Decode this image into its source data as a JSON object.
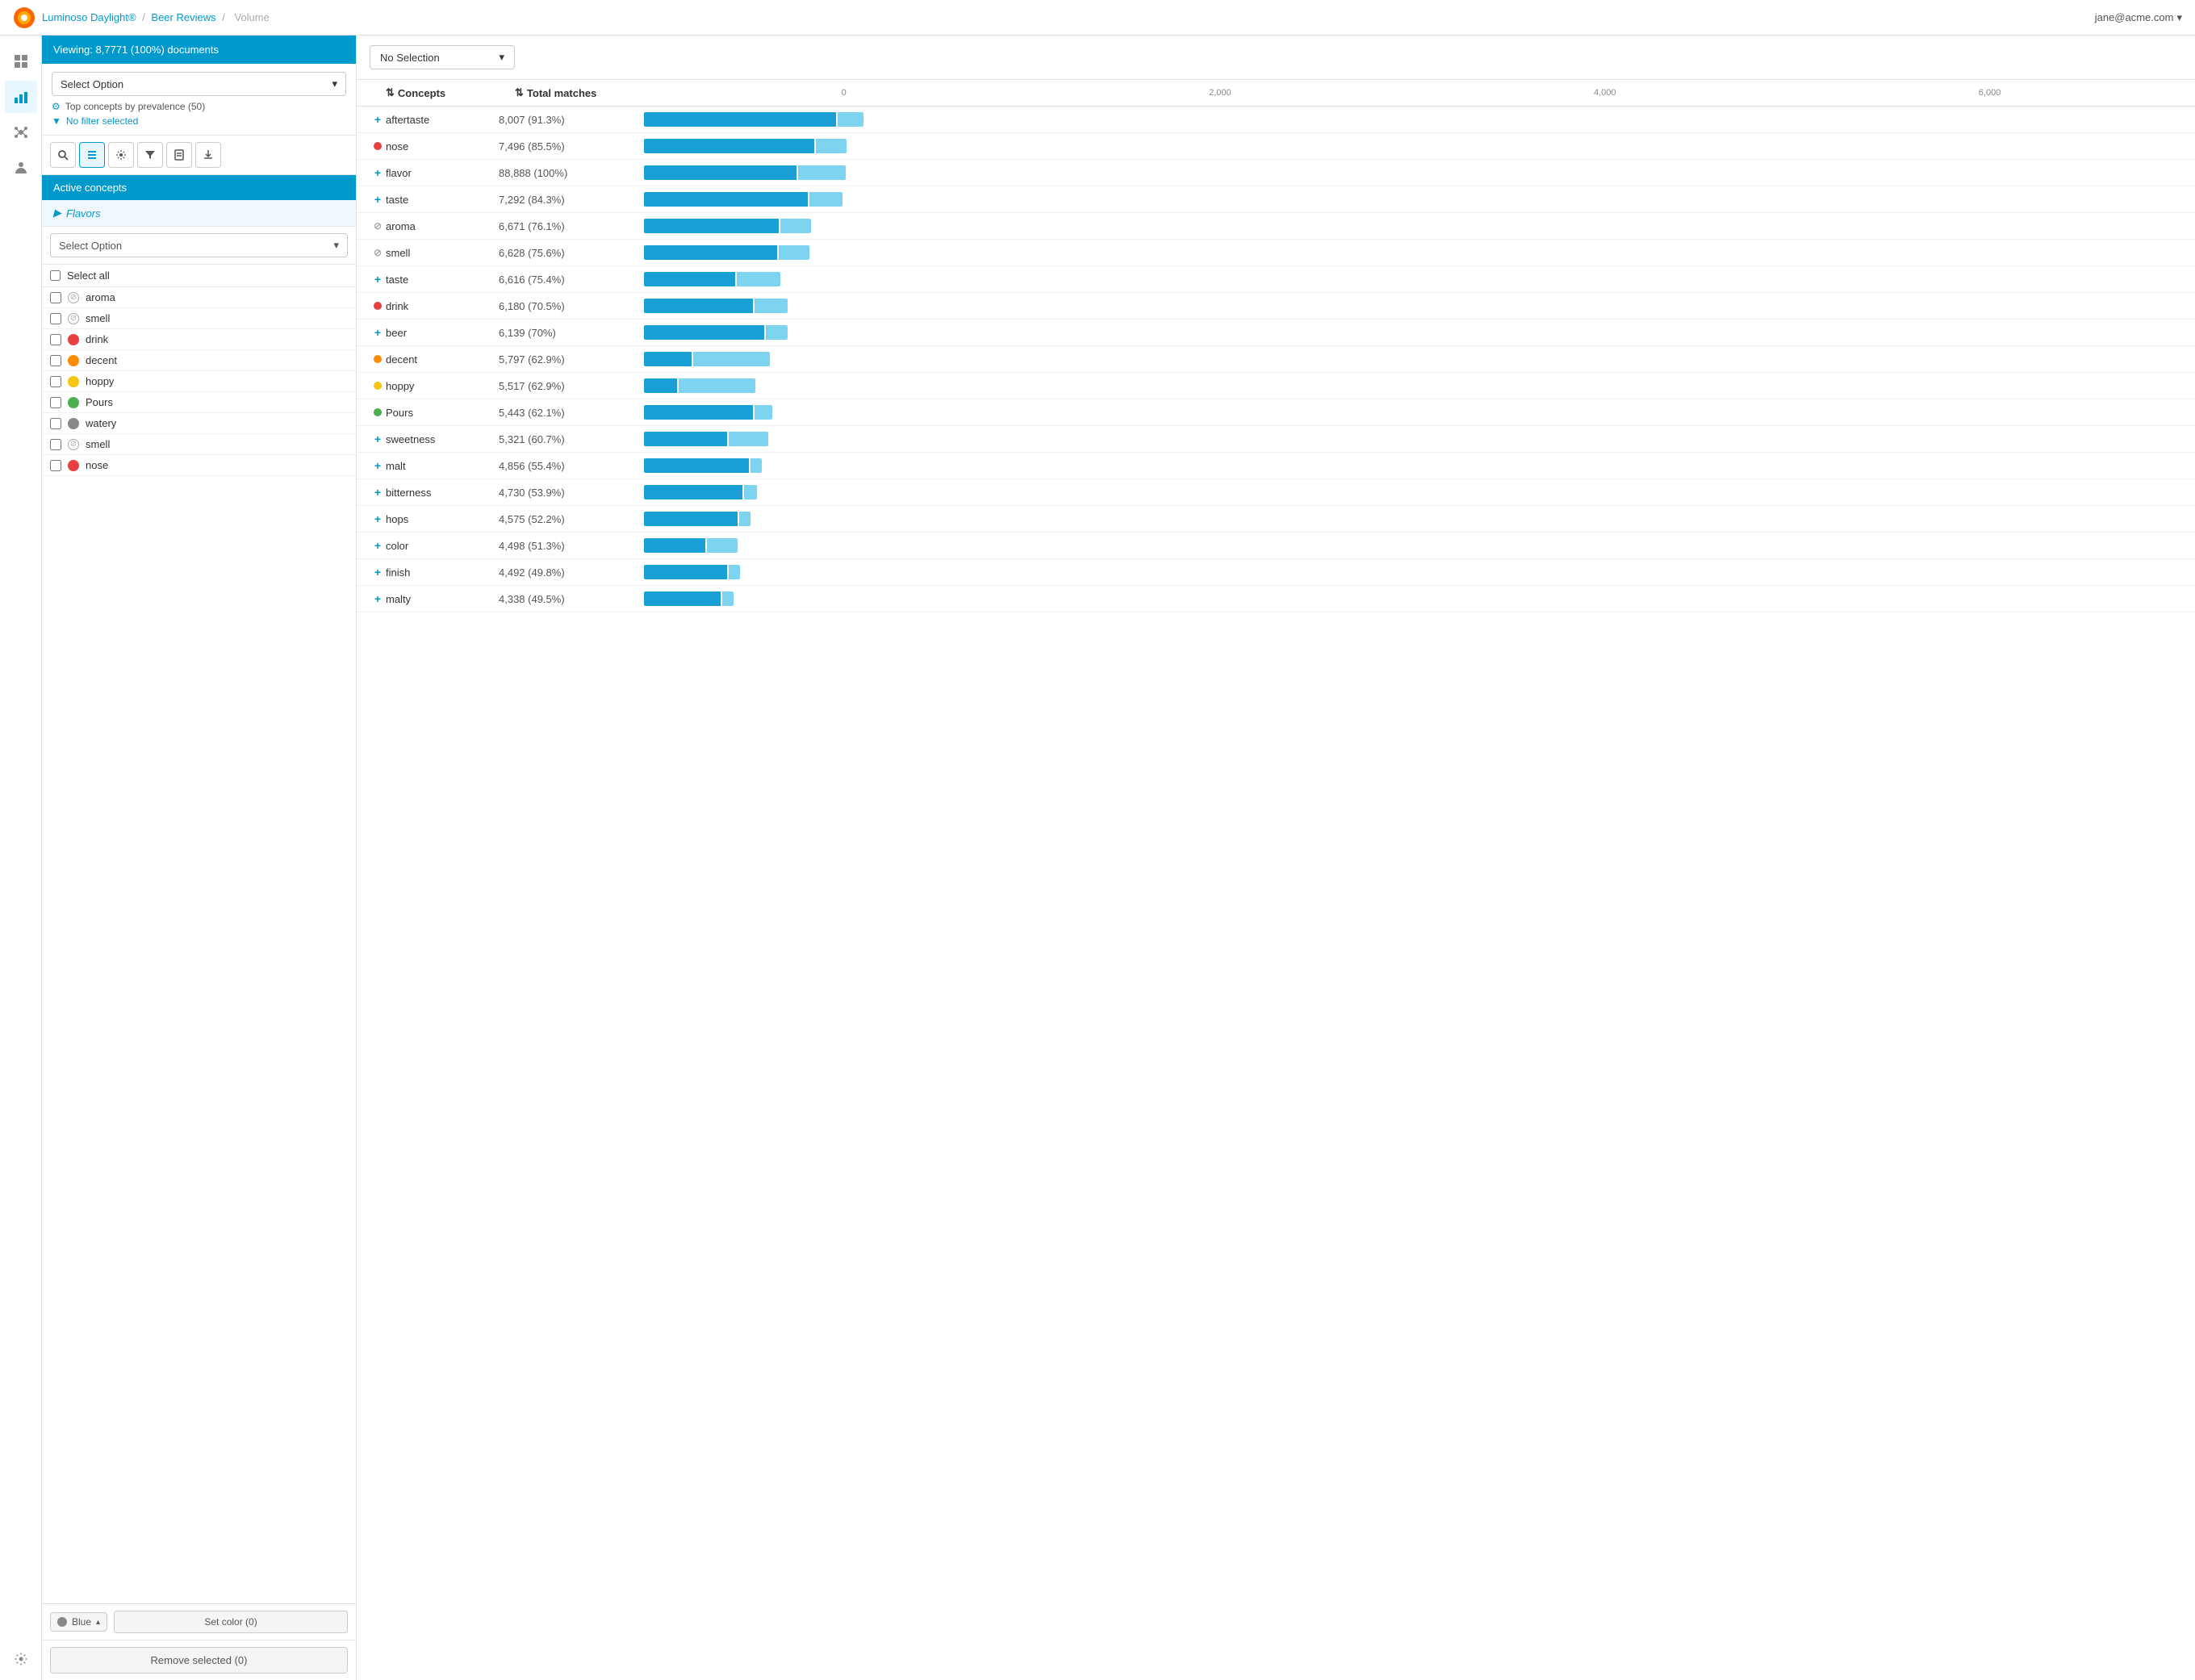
{
  "app": {
    "title": "Luminoso Daylight®",
    "breadcrumb1": "Beer Reviews",
    "breadcrumb2": "Volume",
    "user": "jane@acme.com"
  },
  "leftPanel": {
    "viewing_label": "Viewing: 8,7771 (100%) documents",
    "select_option_label": "Select Option",
    "top_concepts_label": "Top concepts by prevalence (50)",
    "no_filter_label": "No filter selected",
    "active_concepts_label": "Active concepts",
    "flavors_label": "Flavors",
    "concept_select_label": "Select Option",
    "select_all_label": "Select all",
    "concepts": [
      {
        "name": "aroma",
        "type": "blocked",
        "color": ""
      },
      {
        "name": "smell",
        "type": "blocked",
        "color": ""
      },
      {
        "name": "drink",
        "type": "dot",
        "color": "#e84040"
      },
      {
        "name": "decent",
        "type": "dot",
        "color": "#ff8c00"
      },
      {
        "name": "hoppy",
        "type": "dot",
        "color": "#f5c518"
      },
      {
        "name": "Pours",
        "type": "dot",
        "color": "#4caf50"
      },
      {
        "name": "watery",
        "type": "dot",
        "color": "#888"
      },
      {
        "name": "smell",
        "type": "blocked",
        "color": ""
      },
      {
        "name": "nose",
        "type": "dot",
        "color": "#e84040"
      }
    ],
    "color_label": "Blue",
    "set_color_label": "Set color (0)",
    "remove_label": "Remove selected (0)"
  },
  "mainPanel": {
    "no_selection_label": "No Selection",
    "columns": {
      "concepts": "Concepts",
      "total_matches": "Total matches"
    },
    "axis_labels": [
      "0",
      "2,000",
      "4,000",
      "6,000"
    ],
    "rows": [
      {
        "icon": "+",
        "icon_type": "plus",
        "concept": "aftertaste",
        "matches": "8,007",
        "pct": "(91.3%)",
        "bar_dark": 88,
        "bar_light": 12
      },
      {
        "icon": "●",
        "icon_type": "red",
        "concept": "nose",
        "matches": "7,496",
        "pct": "(85.5%)",
        "bar_dark": 78,
        "bar_light": 14
      },
      {
        "icon": "+",
        "icon_type": "plus",
        "concept": "flavor",
        "matches": "88,888",
        "pct": "(100%)",
        "bar_dark": 70,
        "bar_light": 22
      },
      {
        "icon": "+",
        "icon_type": "plus",
        "concept": "taste",
        "matches": "7,292",
        "pct": "(84.3%)",
        "bar_dark": 75,
        "bar_light": 15
      },
      {
        "icon": "⊘",
        "icon_type": "blocked",
        "concept": "aroma",
        "matches": "6,671",
        "pct": "(76.1%)",
        "bar_dark": 62,
        "bar_light": 14
      },
      {
        "icon": "⊘",
        "icon_type": "blocked",
        "concept": "smell",
        "matches": "6,628",
        "pct": "(75.6%)",
        "bar_dark": 61,
        "bar_light": 14
      },
      {
        "icon": "+",
        "icon_type": "plus",
        "concept": "taste",
        "matches": "6,616",
        "pct": "(75.4%)",
        "bar_dark": 42,
        "bar_light": 20
      },
      {
        "icon": "●",
        "icon_type": "red",
        "concept": "drink",
        "matches": "6,180",
        "pct": "(70.5%)",
        "bar_dark": 50,
        "bar_light": 15
      },
      {
        "icon": "+",
        "icon_type": "plus",
        "concept": "beer",
        "matches": "6,139",
        "pct": "(70%)",
        "bar_dark": 55,
        "bar_light": 10
      },
      {
        "icon": "●",
        "icon_type": "orange",
        "concept": "decent",
        "matches": "5,797",
        "pct": "(62.9%)",
        "bar_dark": 22,
        "bar_light": 35
      },
      {
        "icon": "●",
        "icon_type": "yellow",
        "concept": "hoppy",
        "matches": "5,517",
        "pct": "(62.9%)",
        "bar_dark": 15,
        "bar_light": 35
      },
      {
        "icon": "●",
        "icon_type": "green",
        "concept": "Pours",
        "matches": "5,443",
        "pct": "(62.1%)",
        "bar_dark": 50,
        "bar_light": 8
      },
      {
        "icon": "+",
        "icon_type": "plus",
        "concept": "sweetness",
        "matches": "5,321",
        "pct": "(60.7%)",
        "bar_dark": 38,
        "bar_light": 18
      },
      {
        "icon": "+",
        "icon_type": "plus",
        "concept": "malt",
        "matches": "4,856",
        "pct": "(55.4%)",
        "bar_dark": 48,
        "bar_light": 5
      },
      {
        "icon": "+",
        "icon_type": "plus",
        "concept": "bitterness",
        "matches": "4,730",
        "pct": "(53.9%)",
        "bar_dark": 45,
        "bar_light": 6
      },
      {
        "icon": "+",
        "icon_type": "plus",
        "concept": "hops",
        "matches": "4,575",
        "pct": "(52.2%)",
        "bar_dark": 43,
        "bar_light": 5
      },
      {
        "icon": "+",
        "icon_type": "plus",
        "concept": "color",
        "matches": "4,498",
        "pct": "(51.3%)",
        "bar_dark": 28,
        "bar_light": 14
      },
      {
        "icon": "+",
        "icon_type": "plus",
        "concept": "finish",
        "matches": "4,492",
        "pct": "(49.8%)",
        "bar_dark": 38,
        "bar_light": 5
      },
      {
        "icon": "+",
        "icon_type": "plus",
        "concept": "malty",
        "matches": "4,338",
        "pct": "(49.5%)",
        "bar_dark": 35,
        "bar_light": 5
      }
    ]
  },
  "sidebar": {
    "items": [
      {
        "icon": "⊞",
        "name": "grid-icon"
      },
      {
        "icon": "📊",
        "name": "chart-icon"
      },
      {
        "icon": "☁",
        "name": "cluster-icon"
      },
      {
        "icon": "👤",
        "name": "person-icon"
      },
      {
        "icon": "⚙",
        "name": "settings-icon"
      }
    ]
  }
}
